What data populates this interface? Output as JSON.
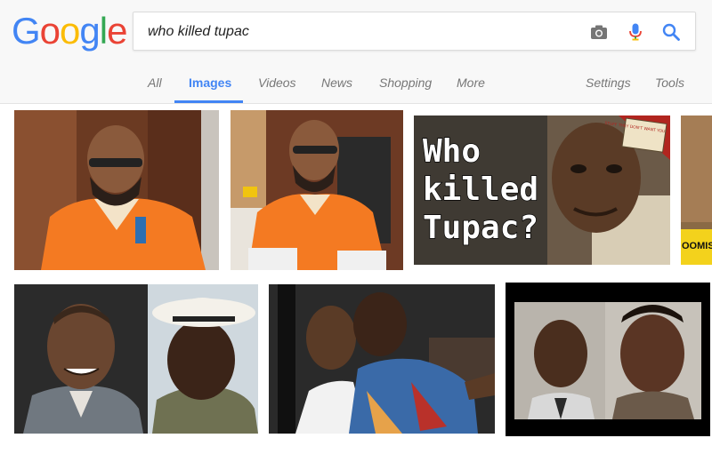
{
  "logo": {
    "letters": [
      {
        "char": "G",
        "color": "#4285f4"
      },
      {
        "char": "o",
        "color": "#ea4335"
      },
      {
        "char": "o",
        "color": "#fbbc05"
      },
      {
        "char": "g",
        "color": "#4285f4"
      },
      {
        "char": "l",
        "color": "#34a853"
      },
      {
        "char": "e",
        "color": "#ea4335"
      }
    ]
  },
  "search": {
    "query": "who killed tupac",
    "camera_icon": "camera-icon",
    "mic_icon": "mic-icon",
    "search_icon": "search-icon"
  },
  "tabs": {
    "all": "All",
    "images": "Images",
    "videos": "Videos",
    "news": "News",
    "shopping": "Shopping",
    "more": "More",
    "settings": "Settings",
    "tools": "Tools"
  },
  "active_tab": "Images",
  "colors": {
    "accent": "#4285f4",
    "header_bg": "#f8f8f8",
    "tab_text": "#777777"
  },
  "results": {
    "thumb3": {
      "title_line1": "Who",
      "title_line2": "killed",
      "title_line3": "Tupac?",
      "badge_text": "STUFF THEY DON'T WANT YOU TO KNOW"
    },
    "thumb4": {
      "label": "OOMIS"
    }
  }
}
